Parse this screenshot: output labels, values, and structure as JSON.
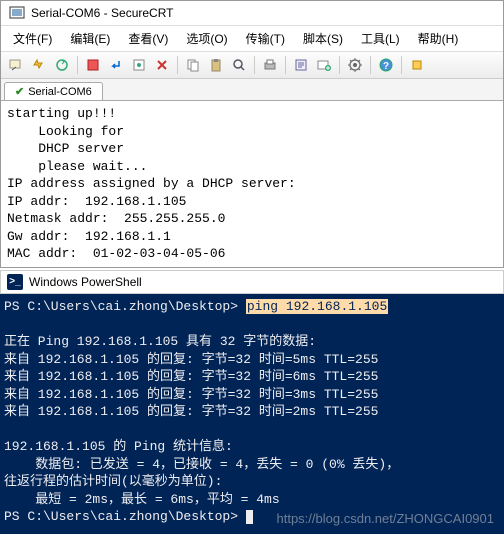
{
  "securecrt": {
    "title": "Serial-COM6 - SecureCRT",
    "menus": {
      "file": "文件(F)",
      "edit": "编辑(E)",
      "view": "查看(V)",
      "options": "选项(O)",
      "transfer": "传输(T)",
      "script": "脚本(S)",
      "tools": "工具(L)",
      "help": "帮助(H)"
    },
    "tab_label": "Serial-COM6",
    "terminal": {
      "l1": "starting up!!!",
      "l2": "    Looking for",
      "l3": "    DHCP server",
      "l4": "    please wait...",
      "l5": "IP address assigned by a DHCP server:",
      "l6": "IP addr:  192.168.1.105",
      "l7": "Netmask addr:  255.255.255.0",
      "l8": "Gw addr:  192.168.1.1",
      "l9": "MAC addr:  01-02-03-04-05-06"
    }
  },
  "powershell": {
    "title": "Windows PowerShell",
    "prompt1": "PS C:\\Users\\cai.zhong\\Desktop> ",
    "cmd": "ping 192.168.1.105",
    "l1": "正在 Ping 192.168.1.105 具有 32 字节的数据:",
    "l2": "来自 192.168.1.105 的回复: 字节=32 时间=5ms TTL=255",
    "l3": "来自 192.168.1.105 的回复: 字节=32 时间=6ms TTL=255",
    "l4": "来自 192.168.1.105 的回复: 字节=32 时间=3ms TTL=255",
    "l5": "来自 192.168.1.105 的回复: 字节=32 时间=2ms TTL=255",
    "l6": "192.168.1.105 的 Ping 统计信息:",
    "l7": "    数据包: 已发送 = 4，已接收 = 4，丢失 = 0 (0% 丢失)，",
    "l8": "往返行程的估计时间(以毫秒为单位):",
    "l9": "    最短 = 2ms，最长 = 6ms，平均 = 4ms",
    "prompt2": "PS C:\\Users\\cai.zhong\\Desktop>"
  },
  "watermark": "https://blog.csdn.net/ZHONGCAI0901"
}
